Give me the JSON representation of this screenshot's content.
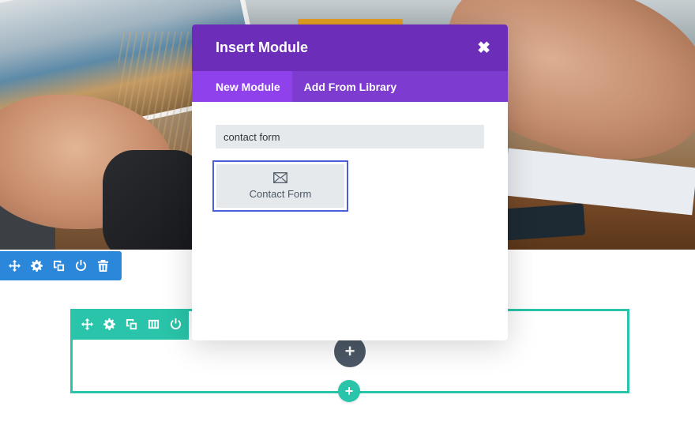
{
  "modal": {
    "title": "Insert Module",
    "close_icon": "close-icon",
    "tabs": [
      {
        "label": "New Module",
        "active": true
      },
      {
        "label": "Add From Library",
        "active": false
      }
    ],
    "search": {
      "value": "contact form"
    },
    "results": [
      {
        "label": "Contact Form",
        "icon": "envelope-icon"
      }
    ]
  },
  "section_toolbar": {
    "color": "#2b87da",
    "icons": [
      "move-icon",
      "settings-icon",
      "duplicate-icon",
      "save-icon",
      "delete-icon"
    ]
  },
  "row_toolbar": {
    "color": "#29c4a9",
    "icons": [
      "move-icon",
      "settings-icon",
      "duplicate-icon",
      "columns-icon",
      "save-icon"
    ]
  },
  "buttons": {
    "add_module_glyph": "+",
    "add_row_glyph": "+"
  },
  "colors": {
    "modal_header": "#6c2eb9",
    "modal_tabs": "#7d3bcf",
    "active_tab": "#8f42ec",
    "selected_outline": "#4a5fd9"
  }
}
